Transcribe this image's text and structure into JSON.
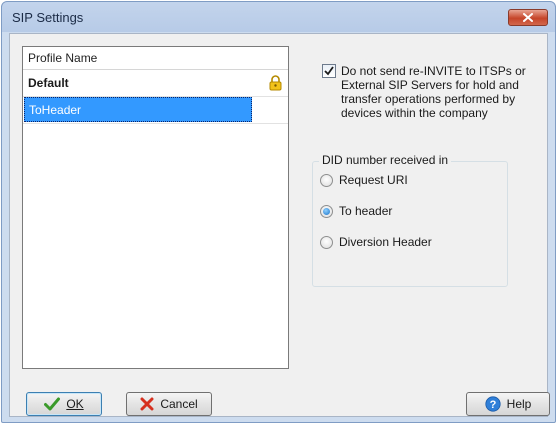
{
  "window": {
    "title": "SIP Settings"
  },
  "profile_list": {
    "header": "Profile Name",
    "items": [
      {
        "label": "Default",
        "bold": true,
        "icon": "lock-icon"
      },
      {
        "label": "ToHeader",
        "selected": true
      }
    ]
  },
  "reinvite_option": {
    "checked": true,
    "label": "Do not send re-INVITE to ITSPs or External SIP Servers for hold and transfer operations performed by devices within the company"
  },
  "did_group": {
    "title": "DID number received in",
    "options": [
      {
        "label": "Request URI",
        "checked": false
      },
      {
        "label": "To header",
        "checked": true
      },
      {
        "label": "Diversion Header",
        "checked": false
      }
    ]
  },
  "buttons": {
    "ok": "OK",
    "cancel": "Cancel",
    "help": "Help"
  },
  "colors": {
    "selection": "#3399ff",
    "titlebar": "#b7cbe7",
    "close": "#c6452a"
  }
}
